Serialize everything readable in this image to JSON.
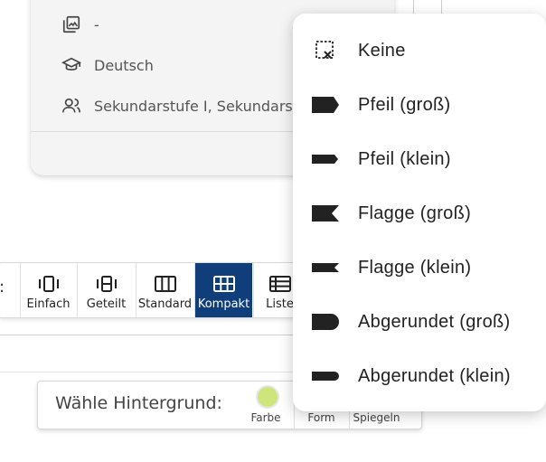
{
  "info_card": {
    "rows": [
      {
        "icon": "image-stack-icon",
        "text": "-"
      },
      {
        "icon": "graduation-cap-icon",
        "text": "Deutsch"
      },
      {
        "icon": "users-icon",
        "text": "Sekundarstufe I, Sekundarstufe II"
      }
    ]
  },
  "view_toolbar": {
    "colon": ":",
    "buttons": [
      {
        "label": "Einfach",
        "icon": "single-card-icon"
      },
      {
        "label": "Geteilt",
        "icon": "split-card-icon"
      },
      {
        "label": "Standard",
        "icon": "columns-icon"
      },
      {
        "label": "Kompakt",
        "icon": "grid-icon",
        "active": true
      },
      {
        "label": "Liste",
        "icon": "list-icon"
      }
    ]
  },
  "background_bar": {
    "label": "Wähle Hintergrund:",
    "tools": [
      {
        "label": "Farbe",
        "icon": "color-dot-icon",
        "color": "#cde57a"
      },
      {
        "label": "Form"
      },
      {
        "label": "Spiegeln"
      }
    ]
  },
  "shape_menu": {
    "items": [
      {
        "label": "Keine",
        "icon": "none-icon"
      },
      {
        "label": "Pfeil (groß)",
        "icon": "arrow-large-icon"
      },
      {
        "label": "Pfeil (klein)",
        "icon": "arrow-small-icon"
      },
      {
        "label": "Flagge (groß)",
        "icon": "flag-large-icon"
      },
      {
        "label": "Flagge (klein)",
        "icon": "flag-small-icon"
      },
      {
        "label": "Abgerundet (groß)",
        "icon": "rounded-large-icon"
      },
      {
        "label": "Abgerundet (klein)",
        "icon": "rounded-small-icon"
      }
    ]
  },
  "colors": {
    "active_view": "#0f3e7a",
    "shape_fill": "#222222",
    "selected_color": "#cde57a"
  }
}
